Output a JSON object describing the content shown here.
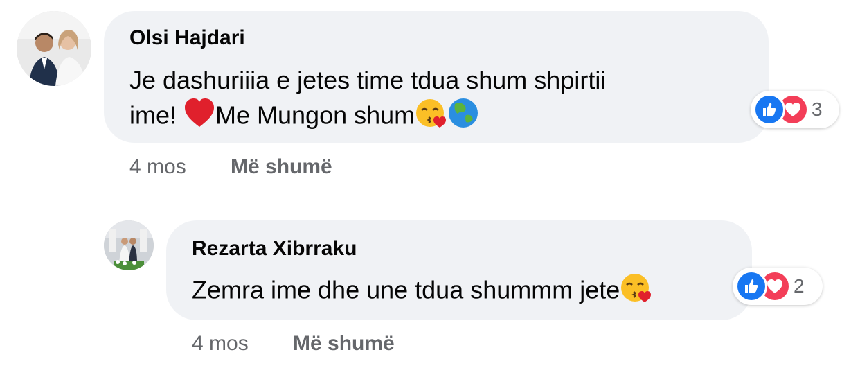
{
  "comments": [
    {
      "author": "Olsi Hajdari",
      "text_line1": "Je dashuriiia e jetes time tdua shum shpirtii",
      "text_line2": "ime! ",
      "text_line2b": "Me Mungon shum",
      "emoji_line2": [
        "red-heart",
        "kissing-face-with-heart",
        "globe-asia-australia"
      ],
      "reaction_count": "3",
      "time": "4 mos",
      "more_label": "Më shumë"
    },
    {
      "author": "Rezarta Xibrraku",
      "text": "Zemra ime dhe une tdua shummm jete",
      "emoji_end": "kissing-face-with-heart",
      "reaction_count": "2",
      "time": "4 mos",
      "more_label": "Më shumë"
    }
  ],
  "colors": {
    "bubble": "#f0f2f5",
    "like": "#1877f2",
    "love": "#f33e58",
    "meta_text": "#65676b"
  }
}
